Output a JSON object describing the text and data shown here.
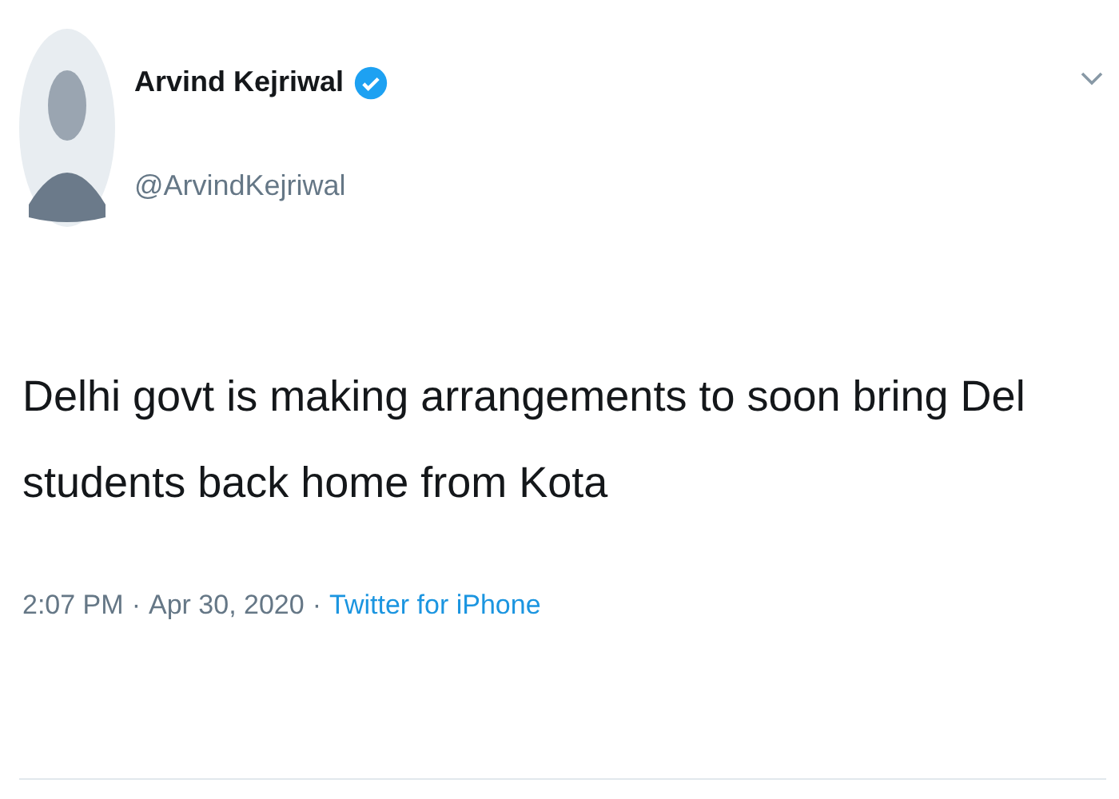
{
  "author": {
    "name": "Arvind Kejriwal",
    "handle": "@ArvindKejriwal",
    "verified": true
  },
  "tweet_lines": [
    "Delhi govt is making arrangements to soon bring Del",
    "students back home from Kota"
  ],
  "meta": {
    "time": "2:07 PM",
    "separator_1": "·",
    "date": "Apr 30, 2020",
    "separator_2": "·",
    "source": "Twitter for iPhone"
  }
}
